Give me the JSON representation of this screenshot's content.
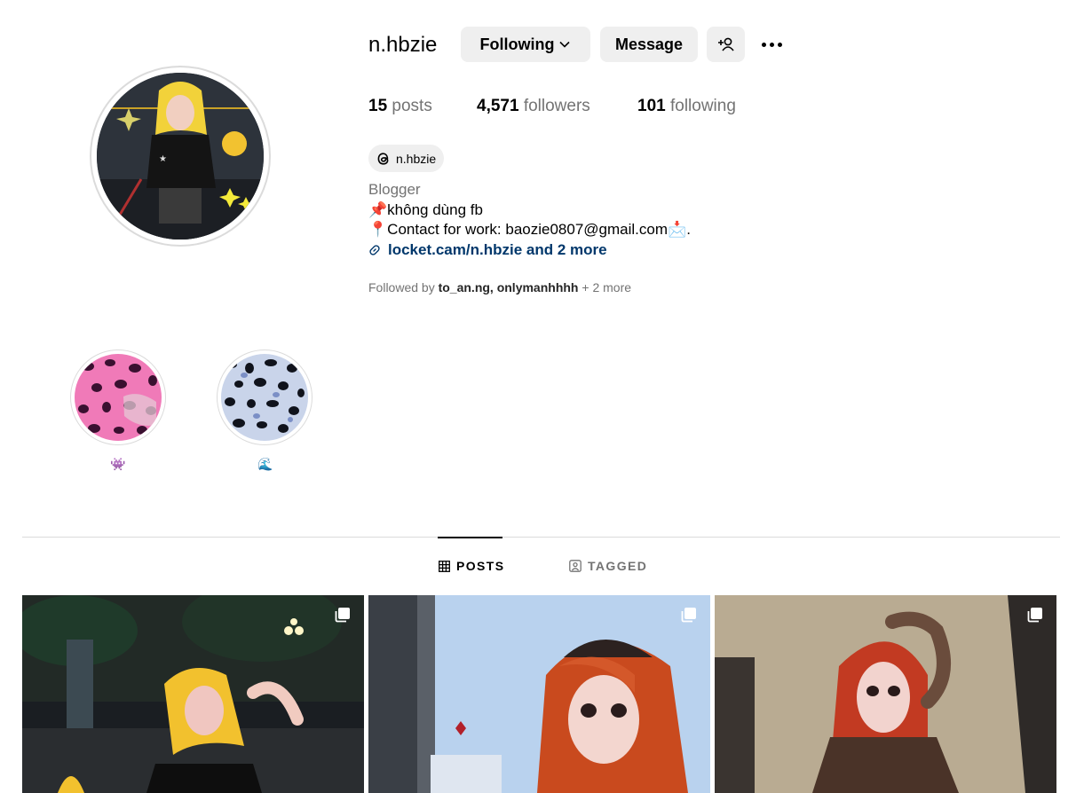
{
  "profile": {
    "username": "n.hbzie",
    "following_button": "Following",
    "message_button": "Message",
    "stats": {
      "posts_count": "15",
      "posts_label": "posts",
      "followers_count": "4,571",
      "followers_label": "followers",
      "following_count": "101",
      "following_label": "following"
    },
    "threads_handle": "n.hbzie",
    "category": "Blogger",
    "bio_line1": "không dùng fb",
    "bio_line2": "Contact for work: baozie0807@gmail.com",
    "bio_line2_suffix": ".",
    "link_text": "locket.cam/n.hbzie and 2 more",
    "followed_by_prefix": "Followed by",
    "followed_by_names": "to_an.ng, onlymanhhhh",
    "followed_by_more": "+ 2 more"
  },
  "highlights": [
    {
      "label": "👾"
    },
    {
      "label": "🌊"
    }
  ],
  "tabs": [
    {
      "label": "POSTS",
      "active": true
    },
    {
      "label": "TAGGED",
      "active": false
    }
  ],
  "colors": {
    "button_bg": "#efefef",
    "secondary_text": "#737373",
    "link": "#00376b",
    "divider": "#dbdbdb"
  }
}
